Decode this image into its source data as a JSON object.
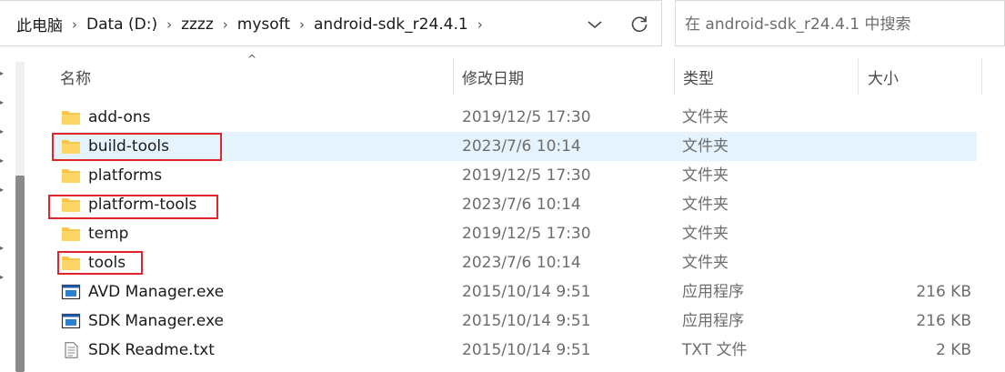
{
  "breadcrumb": {
    "items": [
      "此电脑",
      "Data (D:)",
      "zzzz",
      "mysoft",
      "android-sdk_r24.4.1"
    ],
    "separator": "›"
  },
  "search": {
    "placeholder": "在 android-sdk_r24.4.1 中搜索"
  },
  "columns": {
    "name": "名称",
    "date": "修改日期",
    "type": "类型",
    "size": "大小"
  },
  "files": [
    {
      "name": "add-ons",
      "date": "2019/12/5 17:30",
      "type": "文件夹",
      "size": "",
      "icon": "folder-icon"
    },
    {
      "name": "build-tools",
      "date": "2023/7/6 10:14",
      "type": "文件夹",
      "size": "",
      "icon": "folder-icon"
    },
    {
      "name": "platforms",
      "date": "2019/12/5 17:30",
      "type": "文件夹",
      "size": "",
      "icon": "folder-icon"
    },
    {
      "name": "platform-tools",
      "date": "2023/7/6 10:14",
      "type": "文件夹",
      "size": "",
      "icon": "folder-icon"
    },
    {
      "name": "temp",
      "date": "2019/12/5 17:30",
      "type": "文件夹",
      "size": "",
      "icon": "folder-icon"
    },
    {
      "name": "tools",
      "date": "2023/7/6 10:14",
      "type": "文件夹",
      "size": "",
      "icon": "folder-icon"
    },
    {
      "name": "AVD Manager.exe",
      "date": "2015/10/14 9:51",
      "type": "应用程序",
      "size": "216 KB",
      "icon": "exe-icon"
    },
    {
      "name": "SDK Manager.exe",
      "date": "2015/10/14 9:51",
      "type": "应用程序",
      "size": "216 KB",
      "icon": "exe-icon"
    },
    {
      "name": "SDK Readme.txt",
      "date": "2015/10/14 9:51",
      "type": "TXT 文件",
      "size": "2 KB",
      "icon": "text-file-icon"
    }
  ],
  "colors": {
    "selection": "#e5f3ff",
    "highlight": "#e0262d",
    "folder": "#f8c74a"
  }
}
